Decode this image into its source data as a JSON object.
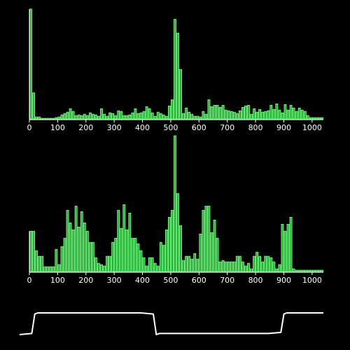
{
  "colors": {
    "background": "#000000",
    "bar_fill": "#22b53a",
    "bar_stroke": "#8dff8d",
    "axis": "#ffffff",
    "waveform": "#ffffff"
  },
  "chart_data": [
    {
      "type": "bar",
      "xlim": [
        0,
        1040
      ],
      "ylim": [
        0,
        165
      ],
      "bin_width": 10,
      "xticks": [
        0,
        100,
        200,
        300,
        400,
        500,
        600,
        700,
        800,
        900,
        1000
      ],
      "tick_labels": [
        "0",
        "100",
        "200",
        "300",
        "400",
        "500",
        "600",
        "700",
        "800",
        "900",
        "1000"
      ],
      "x": [
        0,
        10,
        20,
        30,
        40,
        50,
        60,
        70,
        80,
        90,
        100,
        110,
        120,
        130,
        140,
        150,
        160,
        170,
        180,
        190,
        200,
        210,
        220,
        230,
        240,
        250,
        260,
        270,
        280,
        290,
        300,
        310,
        320,
        330,
        340,
        350,
        360,
        370,
        380,
        390,
        400,
        410,
        420,
        430,
        440,
        450,
        460,
        470,
        480,
        490,
        500,
        510,
        520,
        530,
        540,
        550,
        560,
        570,
        580,
        590,
        600,
        610,
        620,
        630,
        640,
        650,
        660,
        670,
        680,
        690,
        700,
        710,
        720,
        730,
        740,
        750,
        760,
        770,
        780,
        790,
        800,
        810,
        820,
        830,
        840,
        850,
        860,
        870,
        880,
        890,
        900,
        910,
        920,
        930,
        940,
        950,
        960,
        970,
        980,
        990,
        1000,
        1010,
        1020,
        1030
      ],
      "values": [
        160,
        38,
        3,
        3,
        1,
        1,
        1,
        1,
        1,
        2,
        3,
        6,
        8,
        10,
        15,
        11,
        5,
        6,
        5,
        7,
        5,
        9,
        7,
        6,
        4,
        15,
        7,
        4,
        9,
        8,
        5,
        12,
        11,
        5,
        5,
        6,
        9,
        15,
        8,
        9,
        11,
        18,
        15,
        9,
        4,
        10,
        8,
        6,
        4,
        19,
        28,
        145,
        125,
        72,
        8,
        16,
        10,
        7,
        4,
        4,
        3,
        11,
        7,
        28,
        18,
        20,
        20,
        17,
        20,
        13,
        12,
        11,
        10,
        8,
        12,
        17,
        19,
        20,
        7,
        15,
        10,
        14,
        10,
        11,
        12,
        20,
        14,
        22,
        13,
        9,
        21,
        13,
        20,
        16,
        11,
        16,
        13,
        11,
        5,
        2,
        2,
        2,
        2,
        2
      ]
    },
    {
      "type": "bar",
      "xlim": [
        0,
        1040
      ],
      "ylim": [
        0,
        195
      ],
      "bin_width": 10,
      "xticks": [
        0,
        100,
        200,
        300,
        400,
        500,
        600,
        700,
        800,
        900,
        1000
      ],
      "tick_labels": [
        "0",
        "100",
        "200",
        "300",
        "400",
        "500",
        "600",
        "700",
        "800",
        "900",
        "1000"
      ],
      "x": [
        0,
        10,
        20,
        30,
        40,
        50,
        60,
        70,
        80,
        90,
        100,
        110,
        120,
        130,
        140,
        150,
        160,
        170,
        180,
        190,
        200,
        210,
        220,
        230,
        240,
        250,
        260,
        270,
        280,
        290,
        300,
        310,
        320,
        330,
        340,
        350,
        360,
        370,
        380,
        390,
        400,
        410,
        420,
        430,
        440,
        450,
        460,
        470,
        480,
        490,
        500,
        510,
        520,
        530,
        540,
        550,
        560,
        570,
        580,
        590,
        600,
        610,
        620,
        630,
        640,
        650,
        660,
        670,
        680,
        690,
        700,
        710,
        720,
        730,
        740,
        750,
        760,
        770,
        780,
        790,
        800,
        810,
        820,
        830,
        840,
        850,
        860,
        870,
        880,
        890,
        900,
        910,
        920,
        930,
        940,
        950,
        960,
        970,
        980,
        990,
        1000,
        1010,
        1020,
        1030
      ],
      "values": [
        58,
        58,
        30,
        22,
        22,
        7,
        7,
        7,
        7,
        32,
        10,
        36,
        48,
        88,
        70,
        60,
        94,
        64,
        86,
        70,
        58,
        42,
        42,
        20,
        12,
        10,
        8,
        22,
        22,
        42,
        48,
        88,
        62,
        96,
        60,
        84,
        48,
        48,
        40,
        30,
        20,
        8,
        20,
        20,
        12,
        8,
        42,
        38,
        60,
        78,
        88,
        195,
        112,
        66,
        16,
        22,
        22,
        18,
        26,
        18,
        54,
        88,
        94,
        94,
        56,
        74,
        48,
        14,
        16,
        14,
        14,
        14,
        14,
        22,
        22,
        14,
        8,
        12,
        4,
        22,
        28,
        22,
        14,
        22,
        22,
        20,
        14,
        4,
        10,
        68,
        58,
        68,
        78,
        4,
        2,
        2,
        2,
        2,
        2,
        2,
        2,
        2,
        2,
        2
      ]
    },
    {
      "type": "line",
      "waveform_x": [
        0,
        0.04,
        0.05,
        0.06,
        0.4,
        0.44,
        0.45,
        0.46,
        0.82,
        0.86,
        0.87,
        0.88,
        1
      ],
      "waveform_y": [
        0.0,
        0.05,
        0.95,
        1.0,
        1.0,
        0.95,
        0.0,
        0.05,
        0.05,
        0.1,
        0.95,
        1.0,
        1.0
      ]
    }
  ]
}
